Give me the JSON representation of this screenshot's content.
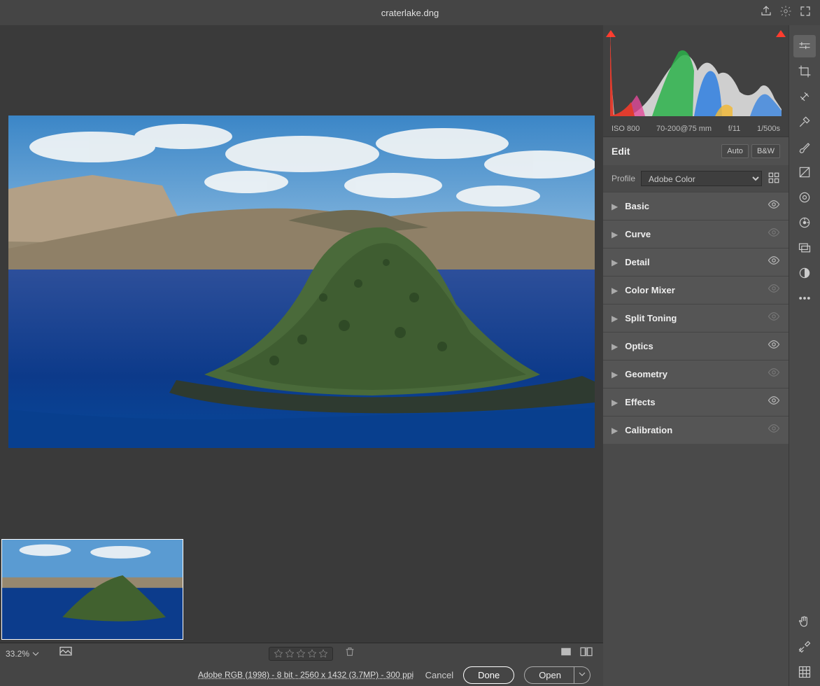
{
  "title": "craterlake.dng",
  "exif": {
    "iso": "ISO 800",
    "lens": "70-200@75 mm",
    "aperture": "f/11",
    "shutter": "1/500s"
  },
  "edit": {
    "header": "Edit",
    "auto": "Auto",
    "bw": "B&W"
  },
  "profile": {
    "label": "Profile",
    "selected": "Adobe Color"
  },
  "panels": [
    {
      "label": "Basic",
      "eyeActive": true
    },
    {
      "label": "Curve",
      "eyeActive": false
    },
    {
      "label": "Detail",
      "eyeActive": true
    },
    {
      "label": "Color Mixer",
      "eyeActive": false
    },
    {
      "label": "Split Toning",
      "eyeActive": false
    },
    {
      "label": "Optics",
      "eyeActive": true
    },
    {
      "label": "Geometry",
      "eyeActive": false
    },
    {
      "label": "Effects",
      "eyeActive": true
    },
    {
      "label": "Calibration",
      "eyeActive": false
    }
  ],
  "zoom": "33.2%",
  "status": {
    "info": "Adobe RGB (1998) - 8 bit - 2560 x 1432 (3.7MP) - 300 ppi",
    "cancel": "Cancel",
    "done": "Done",
    "open": "Open"
  }
}
